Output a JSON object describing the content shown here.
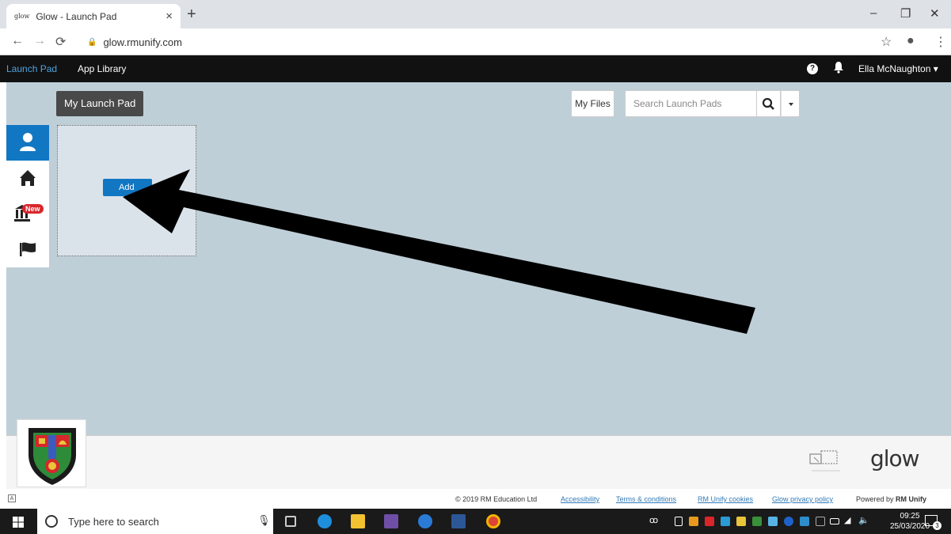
{
  "browser": {
    "tab_title": "Glow - Launch Pad",
    "tab_favicon": "glow",
    "url": "glow.rmunify.com"
  },
  "nav": {
    "launch_pad": "Launch Pad",
    "app_library": "App Library",
    "user_name": "Ella McNaughton",
    "help_glyph": "?"
  },
  "main": {
    "my_launch_pad": "My Launch Pad",
    "my_files": "My Files",
    "search_placeholder": "Search Launch Pads",
    "new_badge": "New",
    "add_button": "Add"
  },
  "footer": {
    "logo_text": "glow",
    "copyright": "© 2019 RM Education Ltd",
    "links": [
      "Accessibility",
      "Terms & conditions",
      "RM Unify cookies",
      "Glow privacy policy"
    ],
    "powered_by": "Powered by",
    "brand": "RM Unify"
  },
  "taskbar": {
    "search_placeholder": "Type here to search",
    "time": "09:25",
    "date": "25/03/2020",
    "notifications": "3"
  },
  "colors": {
    "accent": "#1277c3",
    "nav_active": "#4ea3e0",
    "background": "#bfcfd8",
    "badge": "#d9262b"
  }
}
